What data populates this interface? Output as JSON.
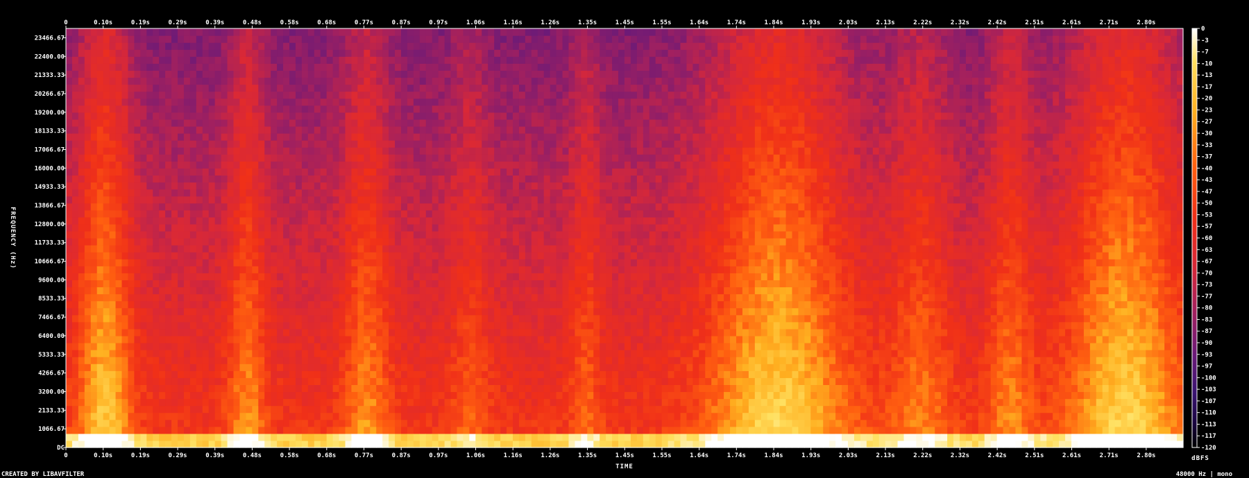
{
  "chart_data": {
    "type": "heatmap",
    "subtype": "spectrogram",
    "xlabel": "TIME",
    "ylabel": "FREQUENCY (Hz)",
    "colorbar_label": "dBFS",
    "x_tick_labels": [
      "0",
      "0.10s",
      "0.19s",
      "0.29s",
      "0.39s",
      "0.48s",
      "0.58s",
      "0.68s",
      "0.77s",
      "0.87s",
      "0.97s",
      "1.06s",
      "1.16s",
      "1.26s",
      "1.35s",
      "1.45s",
      "1.55s",
      "1.64s",
      "1.74s",
      "1.84s",
      "1.93s",
      "2.03s",
      "2.13s",
      "2.22s",
      "2.32s",
      "2.42s",
      "2.51s",
      "2.61s",
      "2.71s",
      "2.80s"
    ],
    "x_tick_values": [
      0,
      0.0967,
      0.1934,
      0.2901,
      0.3868,
      0.4835,
      0.5802,
      0.6769,
      0.7736,
      0.8703,
      0.967,
      1.0637,
      1.1604,
      1.2571,
      1.3538,
      1.4505,
      1.5472,
      1.6439,
      1.7406,
      1.8373,
      1.934,
      2.0307,
      2.1274,
      2.2241,
      2.3208,
      2.4175,
      2.5142,
      2.6109,
      2.7076,
      2.8043
    ],
    "xlim": [
      0,
      2.9
    ],
    "y_tick_labels": [
      "DC",
      "1066.67",
      "2133.33",
      "3200.00",
      "4266.67",
      "5333.33",
      "6400.00",
      "7466.67",
      "8533.33",
      "9600.00",
      "10666.67",
      "11733.33",
      "12800.00",
      "13866.67",
      "14933.33",
      "16000.00",
      "17066.67",
      "18133.33",
      "19200.00",
      "20266.67",
      "21333.33",
      "22400.00",
      "23466.67"
    ],
    "y_tick_values": [
      0,
      1066.67,
      2133.33,
      3200,
      4266.67,
      5333.33,
      6400,
      7466.67,
      8533.33,
      9600,
      10666.67,
      11733.33,
      12800,
      13866.67,
      14933.33,
      16000,
      17066.67,
      18133.33,
      19200,
      20266.67,
      21333.33,
      22400,
      23466.67
    ],
    "ylim": [
      0,
      24000
    ],
    "colorbar_tick_labels": [
      "0",
      "-3",
      "-7",
      "-10",
      "-13",
      "-17",
      "-20",
      "-23",
      "-27",
      "-30",
      "-33",
      "-37",
      "-40",
      "-43",
      "-47",
      "-50",
      "-53",
      "-57",
      "-60",
      "-63",
      "-67",
      "-70",
      "-73",
      "-77",
      "-80",
      "-83",
      "-87",
      "-90",
      "-93",
      "-97",
      "-100",
      "-103",
      "-107",
      "-110",
      "-113",
      "-117",
      "-120"
    ],
    "colorbar_range": [
      -120,
      0
    ],
    "colormap": [
      "#000000",
      "#1a0440",
      "#3a1470",
      "#6a1a78",
      "#a02060",
      "#d82838",
      "#f03018",
      "#ff6010",
      "#ffb020",
      "#ffe060",
      "#ffffff"
    ],
    "grid": false
  },
  "footer": {
    "left": "CREATED BY LIBAVFILTER",
    "right": "48000 Hz | mono"
  }
}
